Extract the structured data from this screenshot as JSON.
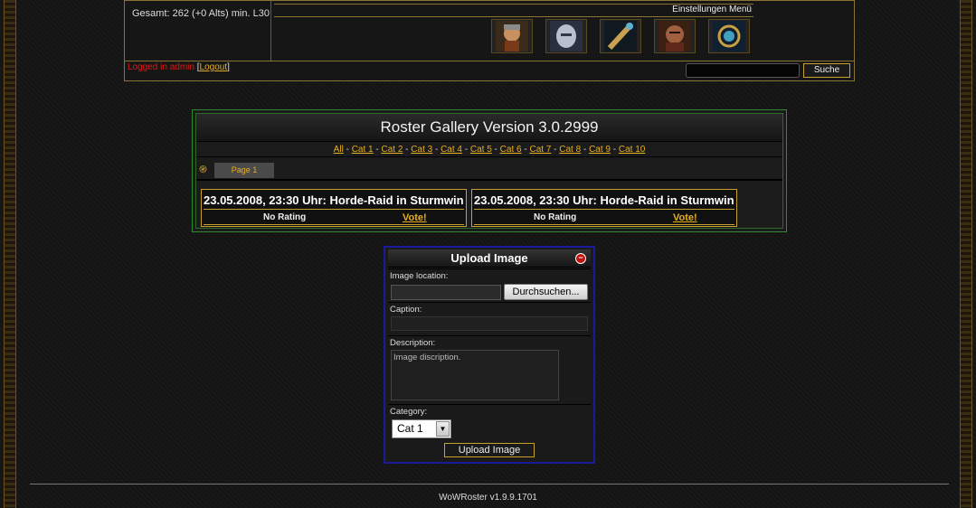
{
  "header": {
    "summary": "Gesamt: 262 (+0 Alts) min. L30",
    "settings_menu": "Einstellungen Menü",
    "login_prefix": "Logged in admin ",
    "logout_bracket_open": "[",
    "logout_label": "Logout",
    "logout_bracket_close": "]",
    "search_button": "Suche",
    "portraits": [
      "human-warrior-portrait",
      "paladin-helm-portrait",
      "spyglass-icon",
      "orc-warrior-portrait",
      "mage-orb-portrait"
    ]
  },
  "gallery": {
    "title": "Roster Gallery Version 3.0.2999",
    "categories": [
      "All",
      "Cat 1",
      "Cat 2",
      "Cat 3",
      "Cat 4",
      "Cat 5",
      "Cat 6",
      "Cat 7",
      "Cat 8",
      "Cat 9",
      "Cat 10"
    ],
    "separator": " - ",
    "page_tab": "Page 1",
    "images": [
      {
        "caption": "23.05.2008, 23:30 Uhr: Horde-Raid in Sturmwind",
        "rating": "No Rating",
        "vote": "Vote!"
      },
      {
        "caption": "23.05.2008, 23:30 Uhr: Horde-Raid in Sturmwind",
        "rating": "No Rating",
        "vote": "Vote!"
      }
    ]
  },
  "upload": {
    "title": "Upload Image",
    "image_location_label": "Image location:",
    "browse_button": "Durchsuchen...",
    "caption_label": "Caption:",
    "description_label": "Description:",
    "description_placeholder": "Image discription.",
    "category_label": "Category:",
    "category_selected": "Cat 1",
    "submit_button": "Upload Image"
  },
  "footer": {
    "version": "WoWRoster v1.9.9.1701"
  },
  "colors": {
    "accent_gold": "#c8a030",
    "link_gold": "#e8b020",
    "login_red": "#e01818",
    "gallery_border": "#2f8a30",
    "upload_border": "#1a1a9a"
  }
}
